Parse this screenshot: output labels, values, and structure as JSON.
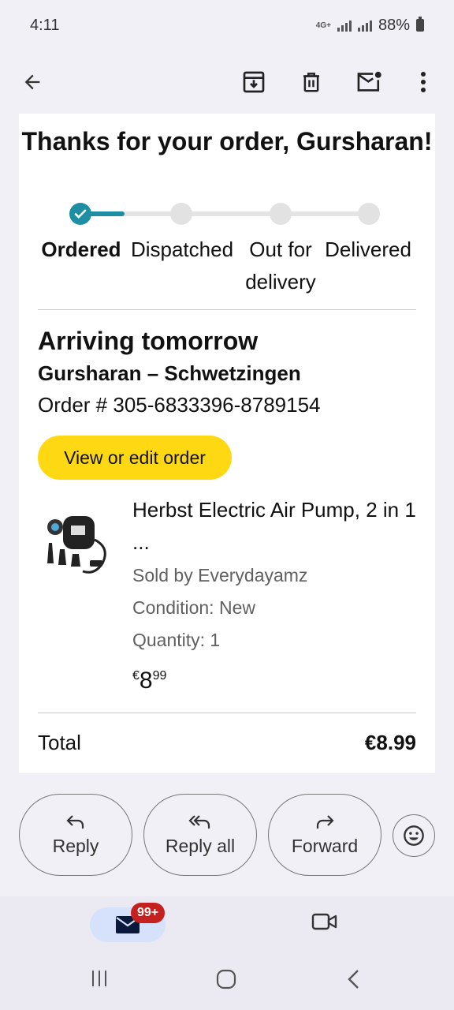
{
  "status_bar": {
    "time": "4:11",
    "network_tag": "4G+",
    "battery": "88%"
  },
  "app_bar": {
    "back_icon": "arrow-back-icon",
    "archive_icon": "archive-icon",
    "delete_icon": "trash-icon",
    "mark_unread_icon": "mark-unread-icon",
    "more_icon": "more-vert-icon"
  },
  "email": {
    "heading": "Thanks for your order, Gursharan!",
    "progress": {
      "completed_fraction": 0.25,
      "steps": [
        {
          "label": "Ordered",
          "done": true
        },
        {
          "label": "Dispatched",
          "done": false
        },
        {
          "label": "Out for delivery",
          "done": false
        },
        {
          "label": "Delivered",
          "done": false
        }
      ]
    },
    "arrival": "Arriving tomorrow",
    "ship_to": "Gursharan – Schwetzingen",
    "order_number": "Order # 305-6833396-8789154",
    "view_order_label": "View or edit order",
    "product": {
      "title": "Herbst Electric Air Pump, 2 in 1 ...",
      "sold_by": "Sold by Everydayamz",
      "condition": "Condition: New",
      "quantity": "Quantity: 1",
      "price_symbol": "€",
      "price_whole": "8",
      "price_fraction": "99"
    },
    "total_label": "Total",
    "total_value": "€8.99"
  },
  "actions": {
    "reply": "Reply",
    "reply_all": "Reply all",
    "forward": "Forward",
    "emoji_icon": "emoji-smile-icon"
  },
  "bottom_nav": {
    "mail_badge": "99+",
    "mail_icon": "mail-icon",
    "meet_icon": "video-camera-icon"
  },
  "colors": {
    "accent_teal": "#1e8fa3",
    "button_yellow": "#ffd814",
    "badge_red": "#c5221f",
    "mail_pill": "#d6e2fb"
  }
}
